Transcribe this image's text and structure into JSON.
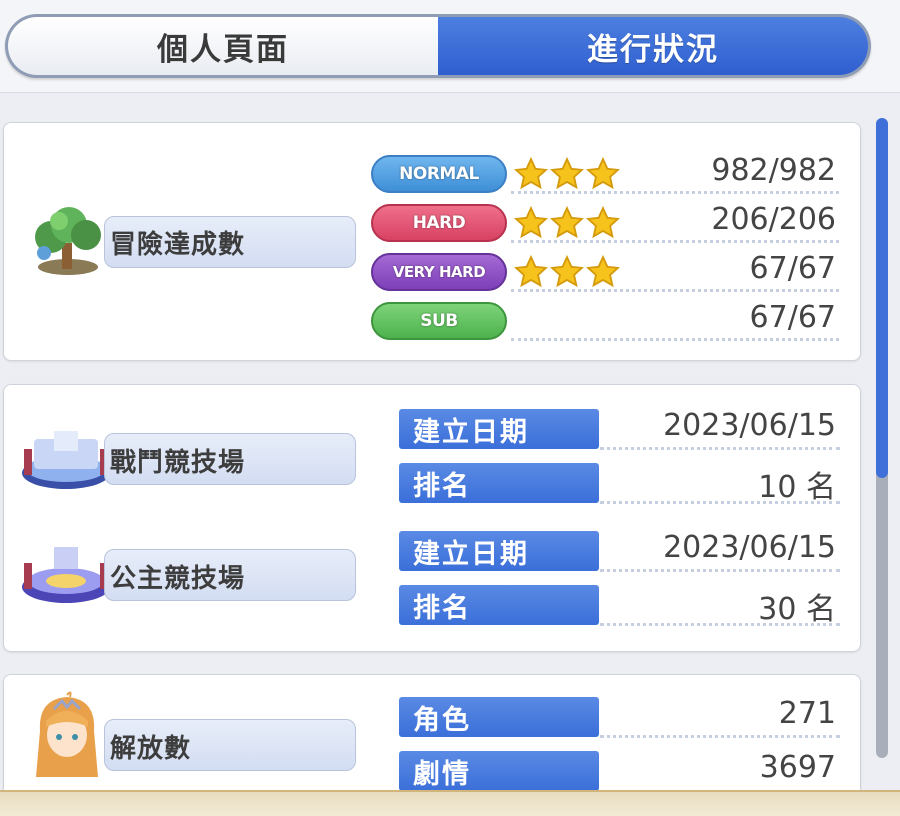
{
  "tabs": {
    "profile": "個人頁面",
    "progress": "進行狀況"
  },
  "adventure": {
    "label": "冒險達成數",
    "rows": [
      {
        "difficulty": "NORMAL",
        "value": "982/982",
        "stars": 3
      },
      {
        "difficulty": "HARD",
        "value": "206/206",
        "stars": 3
      },
      {
        "difficulty": "VERY HARD",
        "value": "67/67",
        "stars": 3
      },
      {
        "difficulty": "SUB",
        "value": "67/67",
        "stars": 0
      }
    ]
  },
  "arena": {
    "label": "戰鬥競技場",
    "created_label": "建立日期",
    "created_value": "2023/06/15",
    "rank_label": "排名",
    "rank_value": "10 名"
  },
  "princess_arena": {
    "label": "公主競技場",
    "created_label": "建立日期",
    "created_value": "2023/06/15",
    "rank_label": "排名",
    "rank_value": "30 名"
  },
  "unlocks": {
    "label": "解放數",
    "character_label": "角色",
    "character_value": "271",
    "story_label": "劇情",
    "story_value": "3697"
  },
  "colors": {
    "accent": "#3b6fd9",
    "normal": "#3f8fd7",
    "hard": "#d84263",
    "very_hard": "#7e3fb8",
    "sub": "#4db14d",
    "star": "#f6c21c"
  }
}
